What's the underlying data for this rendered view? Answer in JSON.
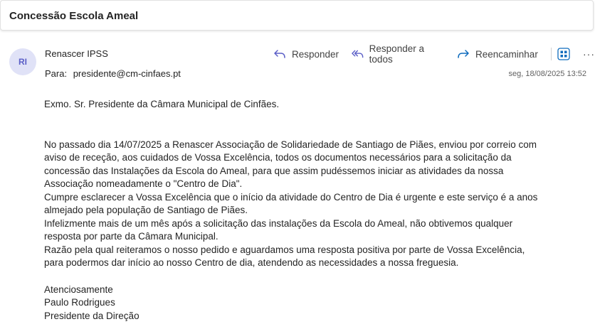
{
  "subject": "Concessão Escola Ameal",
  "sender": {
    "initials": "RI",
    "name": "Renascer IPSS",
    "to_label": "Para:",
    "to_address": "presidente@cm-cinfaes.pt",
    "date": "seg, 18/08/2025 13:52"
  },
  "actions": {
    "reply": "Responder",
    "reply_all": "Responder a todos",
    "forward": "Reencaminhar",
    "more": "···"
  },
  "body": {
    "greeting": "Exmo. Sr. Presidente da Câmara Municipal de Cinfães.",
    "lines": [
      "No passado dia 14/07/2025 a Renascer Associação de Solidariedade de Santiago de Piães, enviou por correio com",
      "aviso de receção, aos cuidados de Vossa Excelência, todos os documentos necessários para a solicitação da",
      "concessão das Instalações da Escola do Ameal, para que assim pudéssemos iniciar as atividades da nossa",
      "Associação nomeadamente o \"Centro de Dia\".",
      "Cumpre esclarecer a Vossa Excelência que o início da atividade do Centro de Dia é urgente e este serviço é a anos",
      "almejado pela população de Santiago de Piães.",
      "Infelizmente mais de um mês após a solicitação das instalações da Escola do Ameal,  não obtivemos qualquer",
      "resposta por parte da Câmara Municipal.",
      "Razão pela qual reiteramos o nosso pedido e aguardamos uma resposta positiva por parte de Vossa Excelência,",
      "para podermos dar início ao nosso Centro de dia, atendendo as necessidades a nossa freguesia."
    ],
    "signature": [
      "Atenciosamente",
      "Paulo Rodrigues",
      "Presidente da Direção"
    ]
  },
  "colors": {
    "accent": "#5b5fc7",
    "forward_icon": "#0f6cbd"
  }
}
